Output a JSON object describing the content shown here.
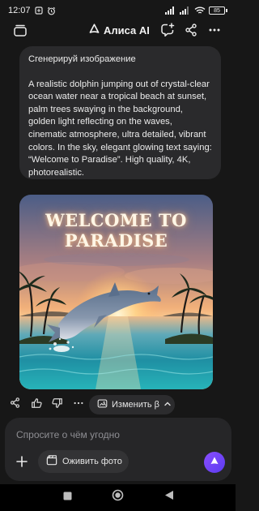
{
  "status_bar": {
    "time": "12:07",
    "battery": "85"
  },
  "header": {
    "title": "Алиса AI"
  },
  "prompt": {
    "line1": "Сгенерируй изображение",
    "line2": "A realistic dolphin jumping out of crystal-clear ocean water near a tropical beach at sunset, palm trees swaying in the background, golden light reflecting on the waves, cinematic atmosphere, ultra detailed, vibrant colors. In the sky, elegant glowing text saying: “Welcome to Paradise”. High quality, 4K, photorealistic."
  },
  "image": {
    "title_line1": "WELCOME TO",
    "title_line2": "PARADISE"
  },
  "actions": {
    "edit_label": "Изменить β"
  },
  "composer": {
    "placeholder": "Спросите о чём угодно",
    "revive_label": "Оживить фото"
  },
  "colors": {
    "background": "#171717",
    "bubble": "#2a2a2c",
    "accent": "#7a45ff"
  }
}
